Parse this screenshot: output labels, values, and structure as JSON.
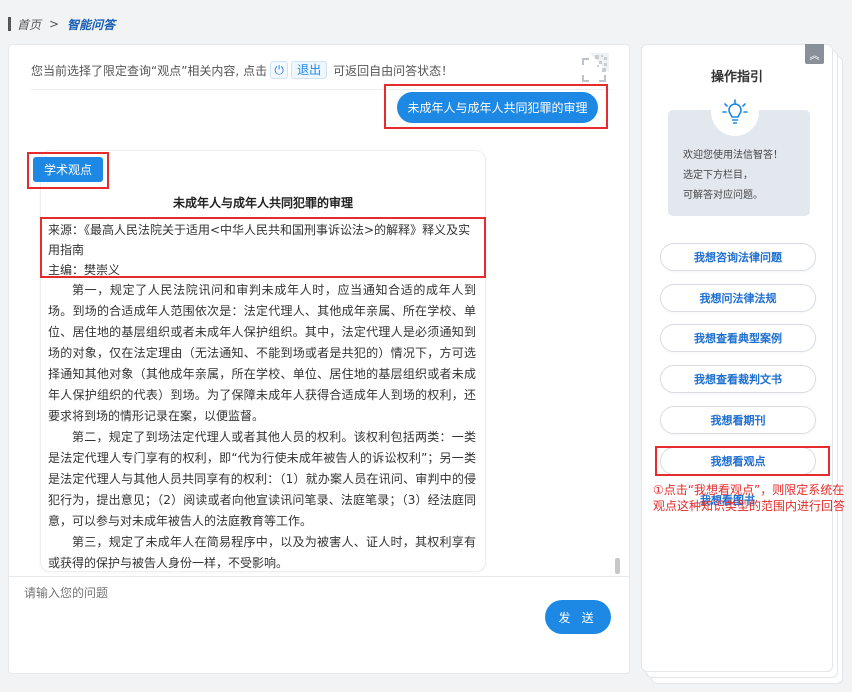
{
  "breadcrumb": {
    "home": "首页",
    "separator": ">",
    "current": "智能问答"
  },
  "notice": {
    "prefix": "您当前选择了限定查询“观点”相关内容, 点击",
    "exit_label": "退出",
    "suffix": "可返回自由问答状态！"
  },
  "user_message": "未成年人与成年人共同犯罪的审理",
  "answer": {
    "tag": "学术观点",
    "title": "未成年人与成年人共同犯罪的审理",
    "source": "来源：《最高人民法院关于适用<中华人民共和国刑事诉讼法>的解释》释义及实用指南",
    "editor": "主编：樊崇义",
    "paragraphs": [
      "第一，规定了人民法院讯问和审判未成年人时，应当通知合适的成年人到场。到场的合适成年人范围依次是：法定代理人、其他成年亲属、所在学校、单位、居住地的基层组织或者未成年人保护组织。其中，法定代理人是必须通知到场的对象，仅在法定理由（无法通知、不能到场或者是共犯的）情况下，方可选择通知其他对象（其他成年亲属，所在学校、单位、居住地的基层组织或者未成年人保护组织的代表）到场。为了保障未成年人获得合适成年人到场的权利，还要求将到场的情形记录在案，以便监督。",
      "第二，规定了到场法定代理人或者其他人员的权利。该权利包括两类：一类是法定代理人专门享有的权利，即“代为行使未成年被告人的诉讼权利”；另一类是法定代理人与其他人员共同享有的权利：（1）就办案人员在讯问、审判中的侵犯行为，提出意见；（2）阅读或者向他宣读讯问笔录、法庭笔录；（3）经法庭同意，可以参与对未成年被告人的法庭教育等工作。",
      "第三，规定了未成年人在简易程序中，以及为被害人、证人时，其权利享有或获得的保护与被告人身份一样，不受影响。"
    ]
  },
  "input": {
    "placeholder": "请输入您的问题",
    "value": ""
  },
  "send_label": "发 送",
  "sidebar": {
    "title": "操作指引",
    "guide_lines": [
      "欢迎您使用法信智答！",
      "选定下方栏目，",
      "可解答对应问题。"
    ],
    "options": [
      "我想咨询法律问题",
      "我想问法律法规",
      "我想查看典型案例",
      "我想查看裁判文书",
      "我想看期刊",
      "我想看观点"
    ],
    "hidden_option_fragment": "我想看图书",
    "annotation": "①点击“我想看观点”，则限定系统在观点这种知识类型的范围内进行回答"
  },
  "colors": {
    "accent": "#1e88e5",
    "highlight": "#e52b2b"
  },
  "icons": {
    "power": "power-icon",
    "qr": "qr-code-icon",
    "bulb": "lightbulb-icon",
    "collapse": "collapse-icon"
  }
}
